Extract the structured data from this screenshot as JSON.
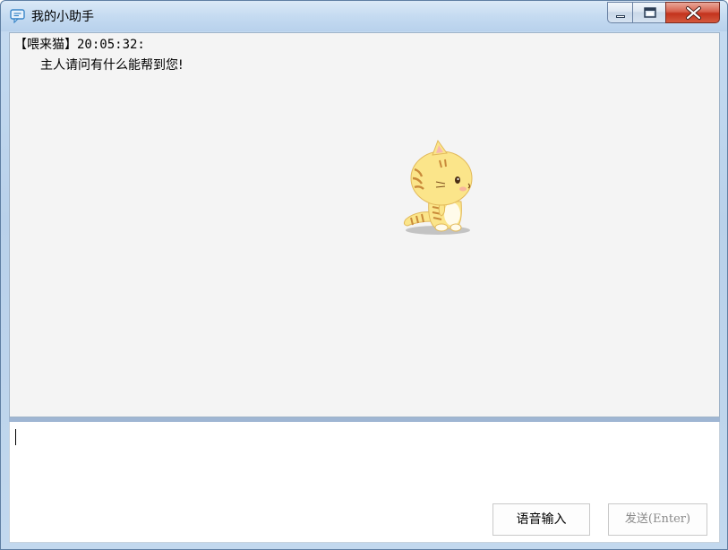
{
  "window": {
    "title": "我的小助手",
    "icons": {
      "app": "chat-bubble-icon",
      "minimize": "minimize-icon",
      "maximize": "maximize-icon",
      "close": "close-icon"
    }
  },
  "chat": {
    "messages": [
      {
        "sender": "【喂来猫】",
        "time": "20:05:32:",
        "text": "主人请问有什么能帮到您!"
      }
    ],
    "mascot": "cat-mascot-icon"
  },
  "input": {
    "value": "",
    "voice_button": "语音输入",
    "send_button": "发送(Enter)"
  },
  "colors": {
    "chat_background": "#f4f4f4",
    "splitter": "#9fb6d3",
    "close_button": "#c3321d",
    "send_disabled_text": "#8a8a8a"
  }
}
